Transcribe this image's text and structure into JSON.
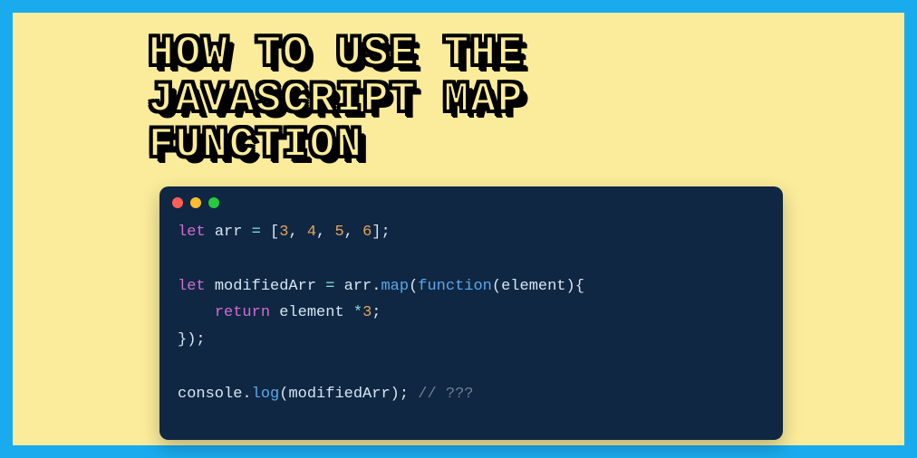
{
  "title": "HOW TO USE THE\nJAVASCRIPT MAP\nFUNCTION",
  "window": {
    "dots": [
      "red",
      "yellow",
      "green"
    ]
  },
  "code": {
    "l1": {
      "kw": "let",
      "sp1": " ",
      "id": "arr",
      "sp2": " ",
      "eq": "=",
      "sp3": " ",
      "lb": "[",
      "n1": "3",
      "c1": ", ",
      "n2": "4",
      "c2": ", ",
      "n3": "5",
      "c3": ", ",
      "n4": "6",
      "rb": "];"
    },
    "blank1": "",
    "l2": {
      "kw": "let",
      "sp1": " ",
      "id": "modifiedArr",
      "sp2": " ",
      "eq": "=",
      "sp3": " ",
      "obj": "arr",
      "dot": ".",
      "method": "map",
      "lp": "(",
      "fkw": "function",
      "lp2": "(",
      "arg": "element",
      "rp2": ")",
      "lb": "{"
    },
    "l3": {
      "indent": "    ",
      "kw": "return",
      "sp": " ",
      "id": "element",
      "sp2": " ",
      "op": "*",
      "n": "3",
      "sc": ";"
    },
    "l4": {
      "rb": "});"
    },
    "blank2": "",
    "l5": {
      "obj": "console",
      "dot": ".",
      "method": "log",
      "lp": "(",
      "arg": "modifiedArr",
      "rp": ");",
      "sp": " ",
      "cm": "// ???"
    }
  }
}
